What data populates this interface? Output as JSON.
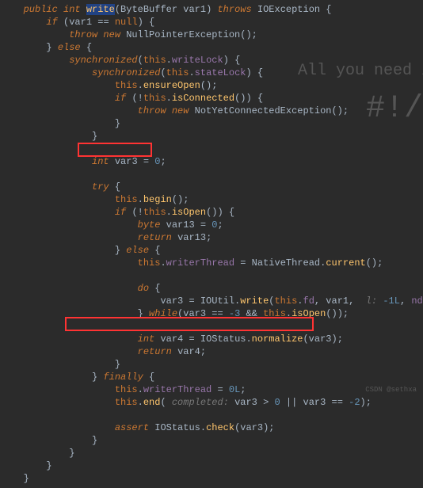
{
  "watermark1": "All you need i",
  "watermark2": "#!/bin/b",
  "footer": "CSDN @sethxa",
  "code": {
    "l1_1": "public int ",
    "l1_2": "write",
    "l1_3": "(ByteBuffer var1) ",
    "l1_4": "throws ",
    "l1_5": "IOException {",
    "l2_1": "if ",
    "l2_2": "(var1 == ",
    "l2_3": "null",
    "l2_4": ") {",
    "l3_1": "throw new ",
    "l3_2": "NullPointerException();",
    "l4": "} ",
    "l4_2": "else ",
    "l4_3": "{",
    "l5_1": "synchronized",
    "l5_2": "(",
    "l5_3": "this",
    "l5_4": ".",
    "l5_5": "writeLock",
    "l5_6": ") {",
    "l6_1": "synchronized",
    "l6_2": "(",
    "l6_3": "this",
    "l6_4": ".",
    "l6_5": "stateLock",
    "l6_6": ") {",
    "l7_1": "this",
    "l7_2": ".",
    "l7_3": "ensureOpen",
    "l7_4": "();",
    "l8_1": "if ",
    "l8_2": "(!",
    "l8_3": "this",
    "l8_4": ".",
    "l8_5": "isConnected",
    "l8_6": "()) {",
    "l9_1": "throw new ",
    "l9_2": "NotYetConnectedException();",
    "l10": "}",
    "l11": "}",
    "l13_1": "int ",
    "l13_2": "var3 = ",
    "l13_3": "0",
    "l13_4": ";",
    "l15_1": "try ",
    "l15_2": "{",
    "l16_1": "this",
    "l16_2": ".",
    "l16_3": "begin",
    "l16_4": "();",
    "l17_1": "if ",
    "l17_2": "(!",
    "l17_3": "this",
    "l17_4": ".",
    "l17_5": "isOpen",
    "l17_6": "()) {",
    "l18_1": "byte ",
    "l18_2": "var13 = ",
    "l18_3": "0",
    "l18_4": ";",
    "l19_1": "return ",
    "l19_2": "var13;",
    "l20": "} ",
    "l20_2": "else ",
    "l20_3": "{",
    "l21_1": "this",
    "l21_2": ".",
    "l21_3": "writerThread ",
    "l21_4": "= NativeThread.",
    "l21_5": "current",
    "l21_6": "();",
    "l23_1": "do ",
    "l23_2": "{",
    "l24_1": "var3 = IOUtil.",
    "l24_2": "write",
    "l24_3": "(",
    "l24_4": "this",
    "l24_5": ".",
    "l24_6": "fd",
    "l24_7": ", var1, ",
    "l24_8": " l: ",
    "l24_9": "-1L",
    "l24_10": ", ",
    "l24_11": "nd",
    "l24_12": ");",
    "l25_1": "} ",
    "l25_2": "while",
    "l25_3": "(var3 == ",
    "l25_4": "-3 ",
    "l25_5": "&& ",
    "l25_6": "this",
    "l25_7": ".",
    "l25_8": "isOpen",
    "l25_9": "());",
    "l27_1": "int ",
    "l27_2": "var4 = IOStatus.",
    "l27_3": "normalize",
    "l27_4": "(var3);",
    "l28_1": "return ",
    "l28_2": "var4;",
    "l29": "}",
    "l30": "} ",
    "l30_2": "finally ",
    "l30_3": "{",
    "l31_1": "this",
    "l31_2": ".",
    "l31_3": "writerThread ",
    "l31_4": "= ",
    "l31_5": "0L",
    "l31_6": ";",
    "l32_1": "this",
    "l32_2": ".",
    "l32_3": "end",
    "l32_4": "(",
    "l32_5": " completed: ",
    "l32_6": "var3 > ",
    "l32_7": "0 ",
    "l32_8": "|| var3 == ",
    "l32_9": "-2",
    "l32_10": ");",
    "l34_1": "assert ",
    "l34_2": "IOStatus.",
    "l34_3": "check",
    "l34_4": "(var3);",
    "l35": "}",
    "l36": "}",
    "l37": "}",
    "l38": "}"
  }
}
